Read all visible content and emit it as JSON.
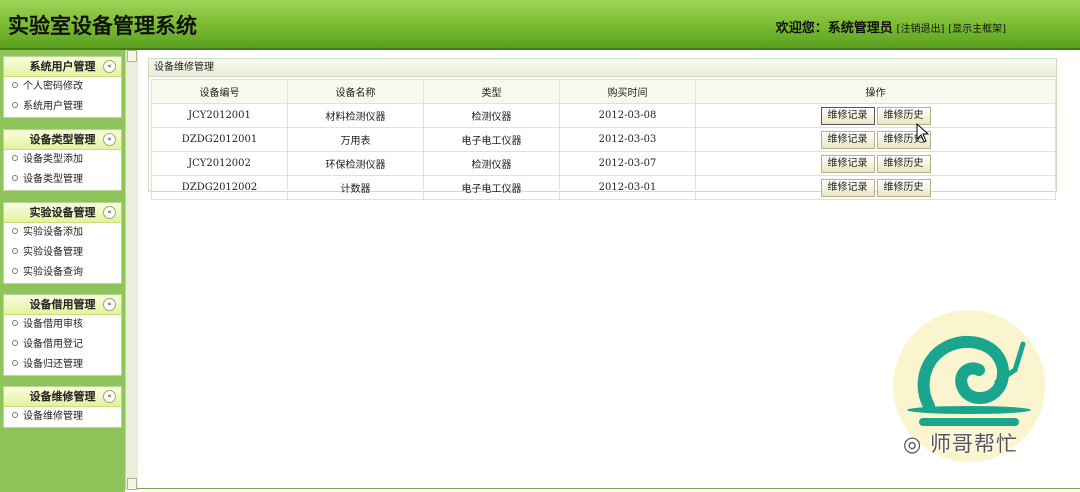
{
  "header": {
    "title": "实验室设备管理系统",
    "welcome_prefix": "欢迎您：",
    "user": "系统管理员",
    "logout": "[注销退出]",
    "show_frame": "[显示主框架]"
  },
  "sidebar": {
    "groups": [
      {
        "title": "系统用户管理",
        "items": [
          "个人密码修改",
          "系统用户管理"
        ]
      },
      {
        "title": "设备类型管理",
        "items": [
          "设备类型添加",
          "设备类型管理"
        ]
      },
      {
        "title": "实验设备管理",
        "items": [
          "实验设备添加",
          "实验设备管理",
          "实验设备查询"
        ]
      },
      {
        "title": "设备借用管理",
        "items": [
          "设备借用审核",
          "设备借用登记",
          "设备归还管理"
        ]
      },
      {
        "title": "设备维修管理",
        "items": [
          "设备维修管理"
        ]
      }
    ],
    "collapse_glyph": "«"
  },
  "main": {
    "section_title": "设备维修管理",
    "columns": [
      "设备编号",
      "设备名称",
      "类型",
      "购买时间",
      "操作"
    ],
    "rows": [
      {
        "id": "JCY2012001",
        "name": "材料检测仪器",
        "type": "检测仪器",
        "date": "2012-03-08"
      },
      {
        "id": "DZDG2012001",
        "name": "万用表",
        "type": "电子电工仪器",
        "date": "2012-03-03"
      },
      {
        "id": "JCY2012002",
        "name": "环保检测仪器",
        "type": "检测仪器",
        "date": "2012-03-07"
      },
      {
        "id": "DZDG2012002",
        "name": "计数器",
        "type": "电子电工仪器",
        "date": "2012-03-01"
      }
    ],
    "btn_record": "维修记录",
    "btn_history": "维修历史"
  },
  "watermark": {
    "text": "师哥帮忙"
  },
  "icons": {
    "collapse": "double-chevron-up-icon",
    "bullet": "circle-bullet-icon",
    "cursor": "mouse-pointer-icon",
    "logo": "snail-logo-icon"
  },
  "colors": {
    "header_green": "#7fbf35",
    "sidebar_green": "#8fc45a",
    "logo_teal": "#1aa58f"
  }
}
